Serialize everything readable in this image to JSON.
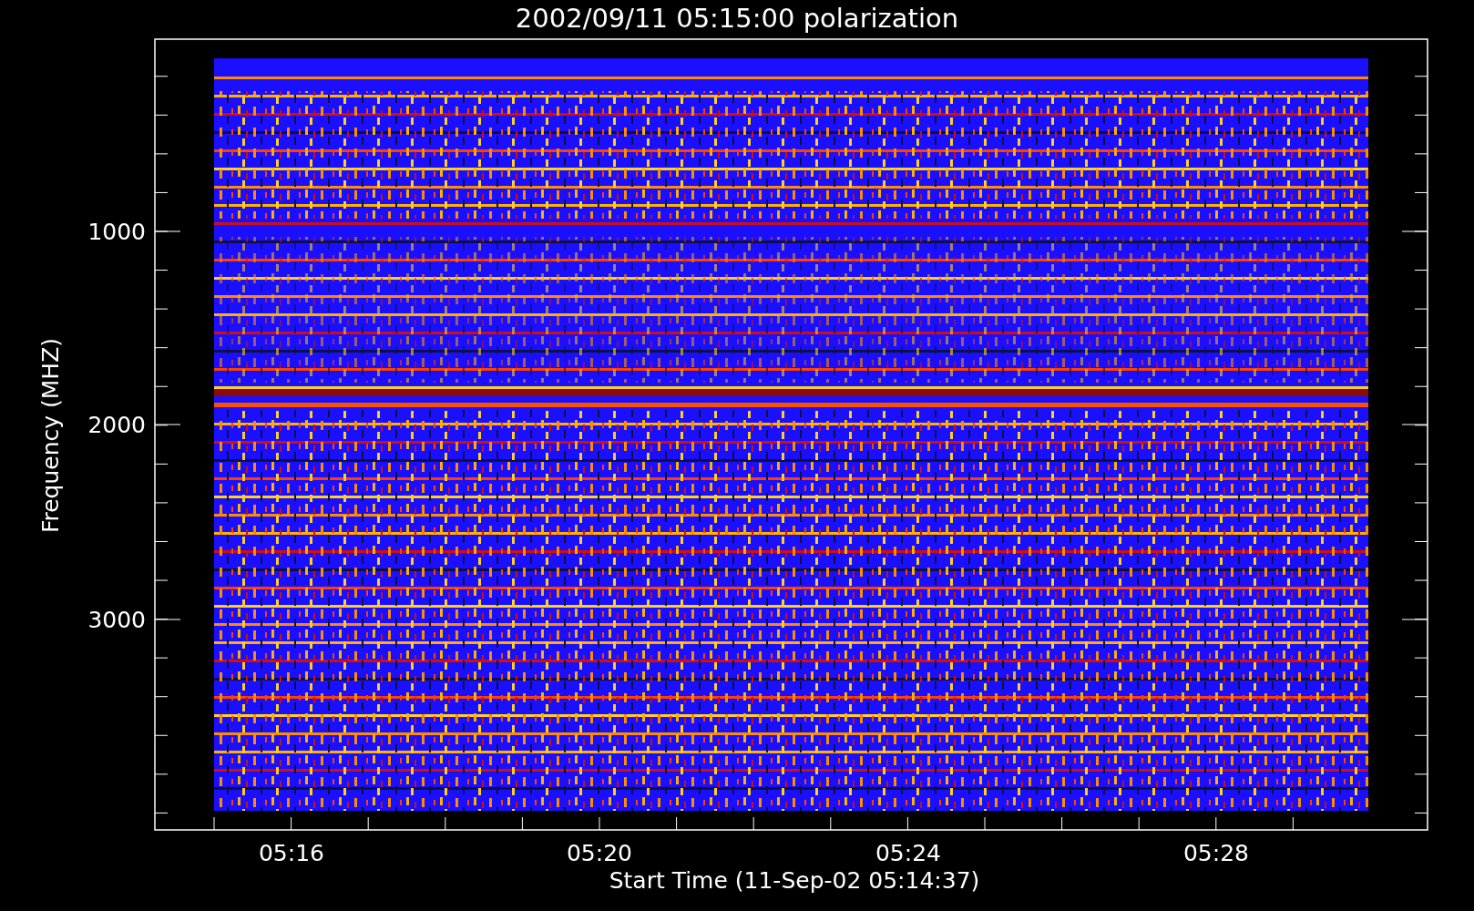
{
  "plot": {
    "title": "2002/09/11 05:15:00 polarization",
    "xlabel": "Start Time (11-Sep-02 05:14:37)",
    "ylabel": "Frequency (MHZ)",
    "yticks": [
      "1000",
      "2000",
      "3000"
    ],
    "xticks": [
      "05:16",
      "05:20",
      "05:24",
      "05:28"
    ]
  }
}
